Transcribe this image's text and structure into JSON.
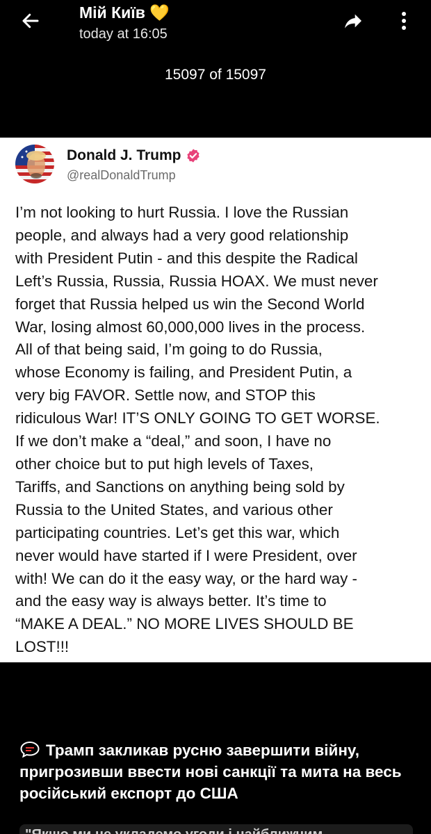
{
  "header": {
    "title": "Мій Київ 💛",
    "subtitle": "today at 16:05",
    "back_icon": "arrow-left-icon",
    "share_icon": "share-icon",
    "more_icon": "more-vertical-icon"
  },
  "viewer": {
    "counter": "15097 of 15097"
  },
  "post": {
    "author_name": "Donald J. Trump",
    "author_handle": "@realDonaldTrump",
    "verified_color": "#e8437a",
    "text": "I’m not looking to hurt Russia. I love the Russian\npeople, and always had a very good relationship\nwith President Putin - and this despite the Radical\nLeft’s Russia, Russia, Russia HOAX. We must never\nforget that Russia helped us win the Second World\nWar, losing almost 60,000,000 lives in the process.\nAll of that being said, I’m going to do Russia,\nwhose Economy is failing, and President Putin, a\nvery big FAVOR. Settle now, and STOP this\nridiculous War! IT’S ONLY GOING TO GET WORSE.\nIf we don’t make a “deal,” and soon, I have no\nother choice but to put high levels of Taxes,\nTariffs, and Sanctions on anything being sold by\nRussia to the United States, and various other\nparticipating countries. Let’s get this war, which\nnever would have started if I were President, over\nwith! We can do it the easy way, or the hard way -\nand the easy way is always better. It’s time to\n“MAKE A DEAL.” NO MORE LIVES SHOULD BE\nLOST!!!"
  },
  "caption": {
    "icon": "speech-bubble-icon",
    "text": "Трамп закликав русню завершити війну, пригрозивши ввести нові санкції та мита на весь російський експорт до США"
  },
  "bottom_peek": {
    "text": "\"Якщо ми не укладемо угоди і найближчим"
  }
}
